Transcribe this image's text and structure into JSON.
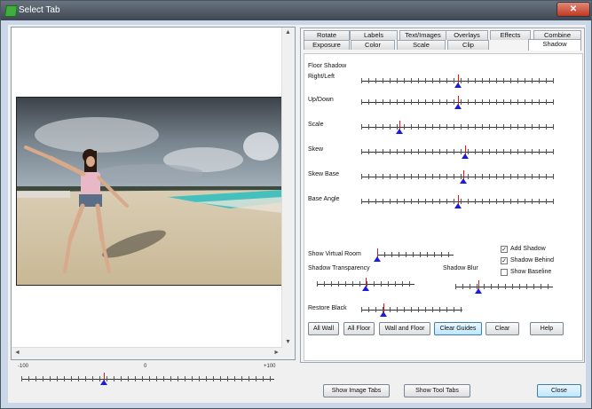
{
  "window": {
    "title": "Select Tab",
    "min_glyph": "_",
    "max_glyph": "□",
    "close_glyph": "✕"
  },
  "tabs_row1": [
    "Rotate",
    "Labels",
    "Text/Images",
    "Overlays",
    "Effects",
    "Combine"
  ],
  "tabs_row2": [
    "Exposure",
    "Color",
    "Scale",
    "Clip",
    "Shadow"
  ],
  "active_tab": "Shadow",
  "floor_shadow": {
    "label": "Floor Shadow"
  },
  "sliders": [
    {
      "label": "Right/Left",
      "value": 0.5
    },
    {
      "label": "Up/Down",
      "value": 0.5
    },
    {
      "label": "Scale",
      "value": 0.2
    },
    {
      "label": "Skew",
      "value": 0.54
    },
    {
      "label": "Skew Base",
      "value": 0.53
    },
    {
      "label": "Base Angle",
      "value": 0.5
    }
  ],
  "virtual_room": {
    "label": "Show Virtual Room",
    "value": 0.0
  },
  "shadow_transparency": {
    "label": "Shadow Transparency",
    "value": 0.5
  },
  "shadow_blur": {
    "label": "Shadow Blur",
    "value": 0.24
  },
  "restore_black": {
    "label": "Restore Black",
    "value": 0.22
  },
  "checkboxes": [
    {
      "label": "Add Shadow",
      "checked": true
    },
    {
      "label": "Shadow Behind",
      "checked": true
    },
    {
      "label": "Show Baseline",
      "checked": false
    }
  ],
  "buttons": {
    "all_wall": "All Wall",
    "all_floor": "All Floor",
    "wall_and_floor": "Wall and Floor",
    "clear_guides": "Clear Guides",
    "clear": "Clear",
    "help": "Help",
    "show_image_tabs": "Show Image Tabs",
    "show_tool_tabs": "Show Tool Tabs",
    "close": "Close"
  },
  "zoom_slider": {
    "min_label": "-100",
    "mid_label": "0",
    "max_label": "+100",
    "value": -35
  },
  "check_glyph": "✓",
  "icons": {
    "scroll_up": "▲",
    "scroll_down": "▼",
    "scroll_left": "◄",
    "scroll_right": "►"
  }
}
